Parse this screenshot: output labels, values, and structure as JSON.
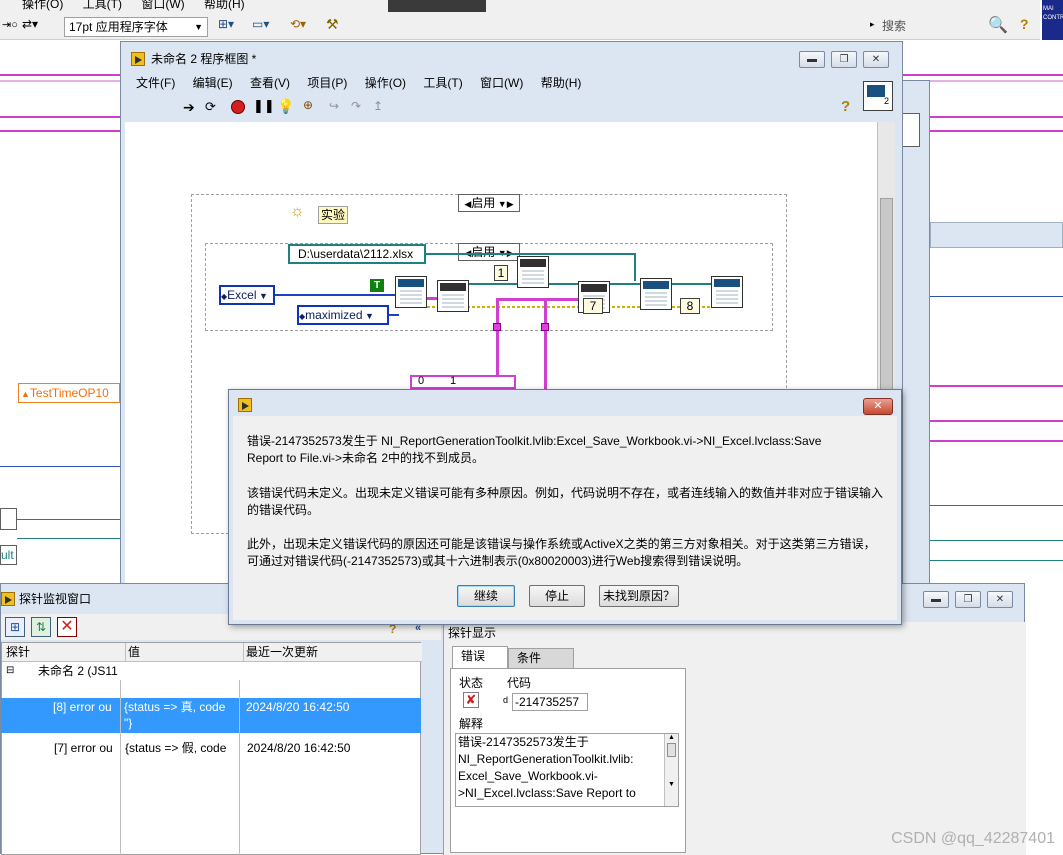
{
  "bg_app": {
    "menu": [
      "操作(O)",
      "工具(T)",
      "窗口(W)",
      "帮助(H)"
    ],
    "font_select": "17pt 应用程序字体",
    "search_placeholder": "搜索",
    "right_thumb_lines": [
      "MAI",
      "CONTR"
    ],
    "string_control": "TestTimeOP10",
    "string_control_tail": "ult",
    "help_glyph": "?"
  },
  "diagram_window": {
    "title": "未命名 2 程序框图 *",
    "menu": [
      "文件(F)",
      "编辑(E)",
      "查看(V)",
      "项目(P)",
      "操作(O)",
      "工具(T)",
      "窗口(W)",
      "帮助(H)"
    ],
    "buttons": {
      "minimize": "▬",
      "restore": "❐",
      "close": "✕"
    },
    "help_glyph": "?",
    "icon_badge": "2",
    "canvas": {
      "outer_case": "启用",
      "inner_case": "启用",
      "label_experiment": "实验",
      "path_constant": "D:\\userdata\\2112.xlsx",
      "enum_excel": "Excel",
      "enum_maximized": "maximized",
      "bool_const": "T",
      "num_1": "1",
      "num_7": "7",
      "num_8": "8",
      "array_index_0": "0",
      "array_value_1": "1"
    }
  },
  "probe_window": {
    "title": "探针监视窗口",
    "columns": [
      "探针",
      "值",
      "最近一次更新"
    ],
    "tree_root": "未命名 2 (JS11",
    "rows": [
      {
        "probe": "[7] error ou",
        "value": "{status => 假, code",
        "time": "2024/8/20 16:42:50",
        "selected": false
      },
      {
        "probe": "[8] error ou",
        "value": "{status => 真, code",
        "value2": "\"}",
        "time": "2024/8/20 16:42:50",
        "selected": true
      }
    ],
    "display_title": "探针显示",
    "tabs": [
      "错误",
      "条件"
    ],
    "status_label": "状态",
    "code_label": "代码",
    "code_value": "-214735257",
    "explain_label": "解释",
    "explain_lines": [
      "错误-2147352573发生于",
      "NI_ReportGenerationToolkit.lvlib:",
      "Excel_Save_Workbook.vi-",
      ">NI_Excel.lvclass:Save Report to"
    ],
    "second_window_buttons": {
      "minimize": "▬",
      "restore": "❐",
      "close": "✕"
    }
  },
  "error_dialog": {
    "close": "✕",
    "paragraph1_line1": "错误-2147352573发生于 NI_ReportGenerationToolkit.lvlib:Excel_Save_Workbook.vi->NI_Excel.lvclass:Save",
    "paragraph1_line2": "Report to File.vi->未命名 2中的找不到成员。",
    "paragraph2_line1": "该错误代码未定义。出现未定义错误可能有多种原因。例如，代码说明不存在，或者连线输入的数值并非对应于错误输入",
    "paragraph2_line2": "的错误代码。",
    "paragraph3_line1": "此外，出现未定义错误代码的原因还可能是该错误与操作系统或ActiveX之类的第三方对象相关。对于这类第三方错误，",
    "paragraph3_line2": "可通过对错误代码(-2147352573)或其十六进制表示(0x80020003)进行Web搜索得到错误说明。",
    "buttons": {
      "continue": "继续",
      "stop": "停止",
      "not_found": "未找到原因？"
    }
  },
  "watermark": "CSDN @qq_42287401"
}
